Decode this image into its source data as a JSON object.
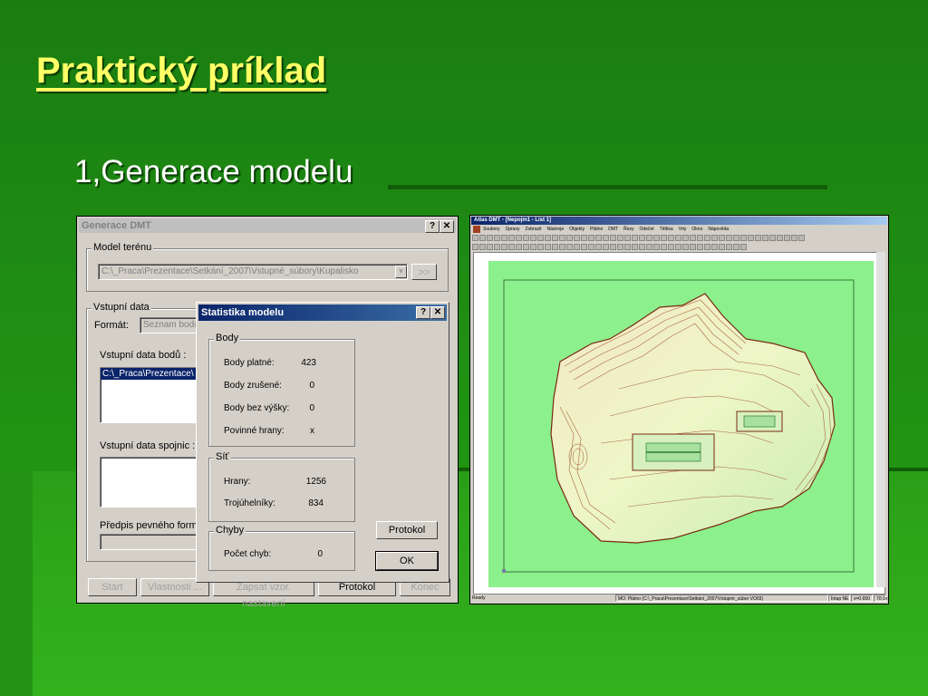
{
  "slide": {
    "title": "Praktický príklad",
    "subtitle": "1,Generace modelu"
  },
  "left_window": {
    "title": "Generace DMT",
    "help_btn": "?",
    "close_btn": "✕",
    "model_group": "Model terénu",
    "model_path": "C:\\_Praca\\Prezentace\\Setkání_2007\\Vstupné_súbory\\Kupalisko",
    "browse_btn": ">>",
    "input_group": "Vstupní data",
    "format_label": "Formát:",
    "format_value": "Seznam bodů",
    "points_label": "Vstupní data bodů :",
    "points_item": "C:\\_Praca\\Prezentace\\",
    "lines_label": "Vstupní data spojnic :",
    "fixed_label": "Předpis pevného formátu",
    "buttons": {
      "start": "Start",
      "props": "Vlastnosti ...",
      "save": "Zapsat vzor. nastavení",
      "protocol": "Protokol",
      "end": "Konec"
    }
  },
  "dialog": {
    "title": "Statistika modelu",
    "help_btn": "?",
    "close_btn": "✕",
    "groups": {
      "body": "Body",
      "sit": "Síť",
      "chyby": "Chyby"
    },
    "body_rows": [
      {
        "label": "Body platné:",
        "value": "423"
      },
      {
        "label": "Body zrušené:",
        "value": "0"
      },
      {
        "label": "Body bez výšky:",
        "value": "0"
      },
      {
        "label": "Povinné hrany:",
        "value": "x"
      }
    ],
    "sit_rows": [
      {
        "label": "Hrany:",
        "value": "1256"
      },
      {
        "label": "Trojúhelníky:",
        "value": "834"
      }
    ],
    "chyby_rows": [
      {
        "label": "Počet chyb:",
        "value": "0"
      }
    ],
    "protocol_btn": "Protokol",
    "ok_btn": "OK"
  },
  "right_window": {
    "title": "Atlas DMT - [Nepojm1 - List 1]",
    "menu": [
      "Soubory",
      "Úpravy",
      "Zobrazit",
      "Nástroje",
      "Objekty",
      "Plátno",
      "DMT",
      "Řezy",
      "Odečet",
      "Tělěsa",
      "Vrty",
      "Okno",
      "Nápověda"
    ],
    "status": {
      "ready": "Ready",
      "path": "MO: Plátno (C:\\_Praca\\Prezentace\\Setkání_2007\\Vstupné_súbor  VO03)",
      "mode": "Íntap NE",
      "zoom": "x=0.650",
      "page": "70:1n"
    },
    "canvas_colors": {
      "page_bg": "#90f090",
      "terrain_light": "#f0f6c8",
      "contour": "#8b3a1a"
    }
  }
}
